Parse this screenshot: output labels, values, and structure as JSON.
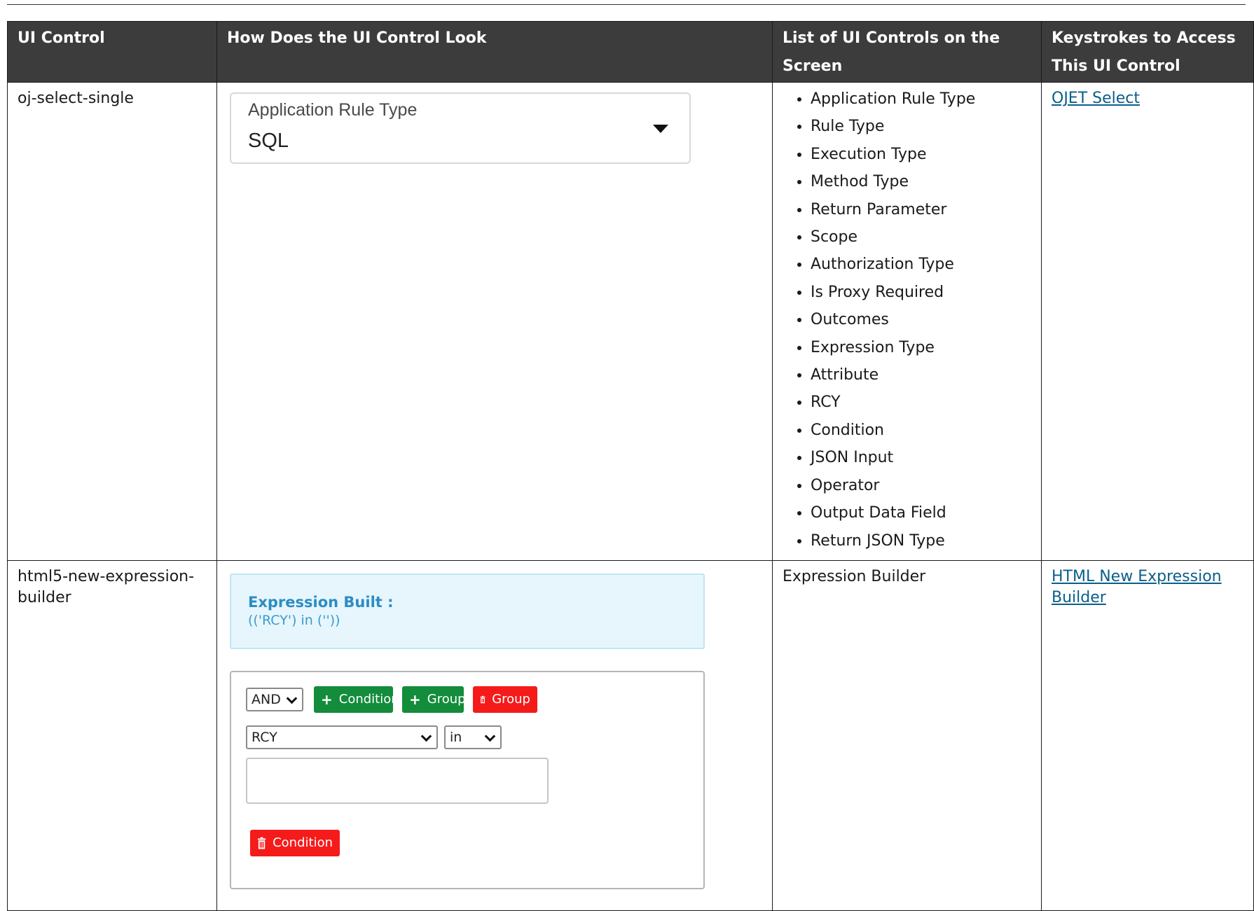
{
  "table": {
    "headers": [
      "UI Control",
      "How Does the UI Control Look",
      "List of UI Controls on the Screen",
      "Keystrokes to Access This UI Control"
    ],
    "rows": [
      {
        "control": "oj-select-single",
        "preview": {
          "label": "Application Rule Type",
          "value": "SQL"
        },
        "controls_list": [
          "Application Rule Type",
          "Rule Type",
          "Execution Type",
          "Method Type",
          "Return Parameter",
          "Scope",
          "Authorization Type",
          "Is Proxy Required",
          "Outcomes",
          "Expression Type",
          "Attribute",
          "RCY",
          "Condition",
          "JSON Input",
          "Operator",
          "Output Data Field",
          "Return JSON Type"
        ],
        "keystroke_link": "OJET Select"
      },
      {
        "control": "html5-new-expression-builder",
        "preview": {
          "expression_title": "Expression Built :",
          "expression_text": "(('RCY') in (''))",
          "logic_select": "AND",
          "add_condition_label": "Condition",
          "add_group_label": "Group",
          "delete_group_label": "Group",
          "field_select": "RCY",
          "operator_select": "in",
          "delete_condition_label": "Condition"
        },
        "controls_list_text": "Expression Builder",
        "keystroke_link": "HTML New Expression Builder"
      }
    ]
  },
  "colors": {
    "header_bg": "#3c3c3c",
    "link": "#0b5e8a",
    "button_green": "#138c3b",
    "button_red": "#f51b1b",
    "expression_bg": "#e6f6fc"
  },
  "icons": [
    "caret-down-icon",
    "chevron-down-icon",
    "plus-icon",
    "trash-icon"
  ]
}
